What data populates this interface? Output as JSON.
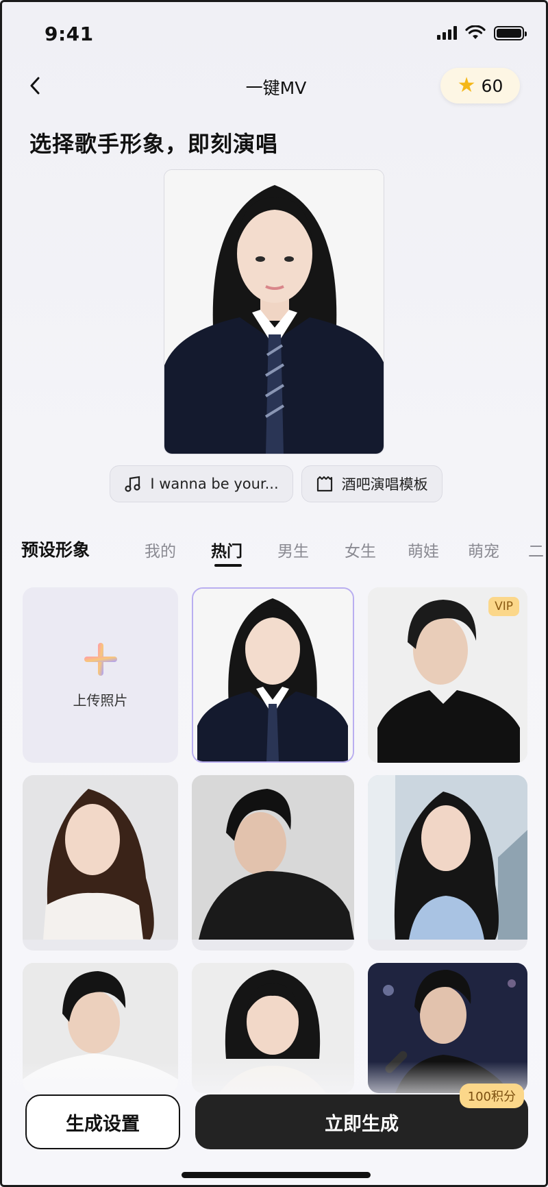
{
  "status_bar": {
    "time": "9:41"
  },
  "nav": {
    "title": "一键MV",
    "points": "60",
    "star_icon": "star-icon"
  },
  "headline": "选择歌手形象，即刻演唱",
  "chips": [
    {
      "icon": "music-note-icon",
      "label": "I wanna be your..."
    },
    {
      "icon": "clapper-icon",
      "label": "酒吧演唱模板"
    }
  ],
  "tabs": {
    "section_label": "预设形象",
    "items": [
      "我的",
      "热门",
      "男生",
      "女生",
      "萌娃",
      "萌宠",
      "二"
    ],
    "active": "热门"
  },
  "grid": {
    "upload_label": "上传照片",
    "vip_label": "VIP"
  },
  "actions": {
    "settings_label": "生成设置",
    "generate_label": "立即生成",
    "cost_label": "100积分"
  },
  "colors": {
    "accent_gold": "#fbd78a",
    "dark_button": "#232323",
    "selection_border": "#b9aef0"
  }
}
